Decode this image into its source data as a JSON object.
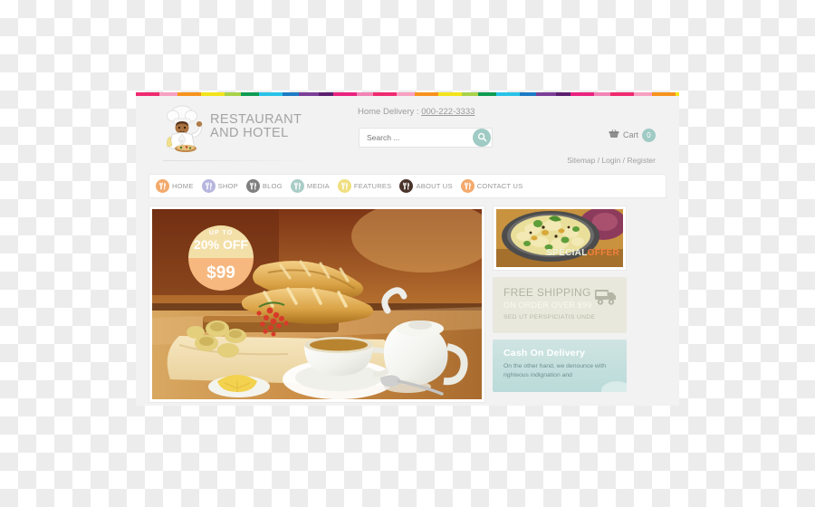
{
  "site": {
    "brand": {
      "line1": "RESTAURANT",
      "line2": "AND HOTEL",
      "logo_icon": "chef-illustration"
    },
    "header": {
      "delivery_label": "Home Delivery : ",
      "delivery_phone": "000-222-3333",
      "search_placeholder": "Search ...",
      "search_value": "",
      "search_icon": "magnifier-icon",
      "cart_icon": "shopping-basket-icon",
      "cart_label": "Cart",
      "cart_count": "0",
      "toplinks": "Sitemap / Login / Register"
    },
    "nav": [
      {
        "label": "HOME",
        "icon": "fork-knife-icon",
        "color": "#f3a96b"
      },
      {
        "label": "SHOP",
        "icon": "fork-knife-icon",
        "color": "#b7b6de"
      },
      {
        "label": "BLOG",
        "icon": "fork-knife-icon",
        "color": "#7f7f7f"
      },
      {
        "label": "MEDIA",
        "icon": "fork-knife-icon",
        "color": "#a9cdc6"
      },
      {
        "label": "FEATURES",
        "icon": "fork-knife-icon",
        "color": "#efdf7f"
      },
      {
        "label": "ABOUT US",
        "icon": "fork-knife-icon",
        "color": "#4a342a"
      },
      {
        "label": "CONTACT US",
        "icon": "fork-knife-icon",
        "color": "#f3a96b"
      }
    ],
    "hero": {
      "image_alt": "bread-basket-tea-table-photo",
      "badge_upto": "UP TO",
      "badge_discount": "20% OFF",
      "badge_price": "$99"
    },
    "sidebar": {
      "special": {
        "image_alt": "fried-rice-bowl-photo",
        "label_part1": "SPECIAL",
        "label_part2": "OFFER"
      },
      "shipping": {
        "title": "FREE SHIPPING",
        "subtitle": "ON ORDER OVER $99",
        "caption": "SED UT PERSPICIATIS UNDE",
        "icon": "delivery-truck-icon"
      },
      "cod": {
        "title": "Cash On Delivery",
        "body": "On the other hand, we denounce with righteous indignation and"
      }
    }
  }
}
